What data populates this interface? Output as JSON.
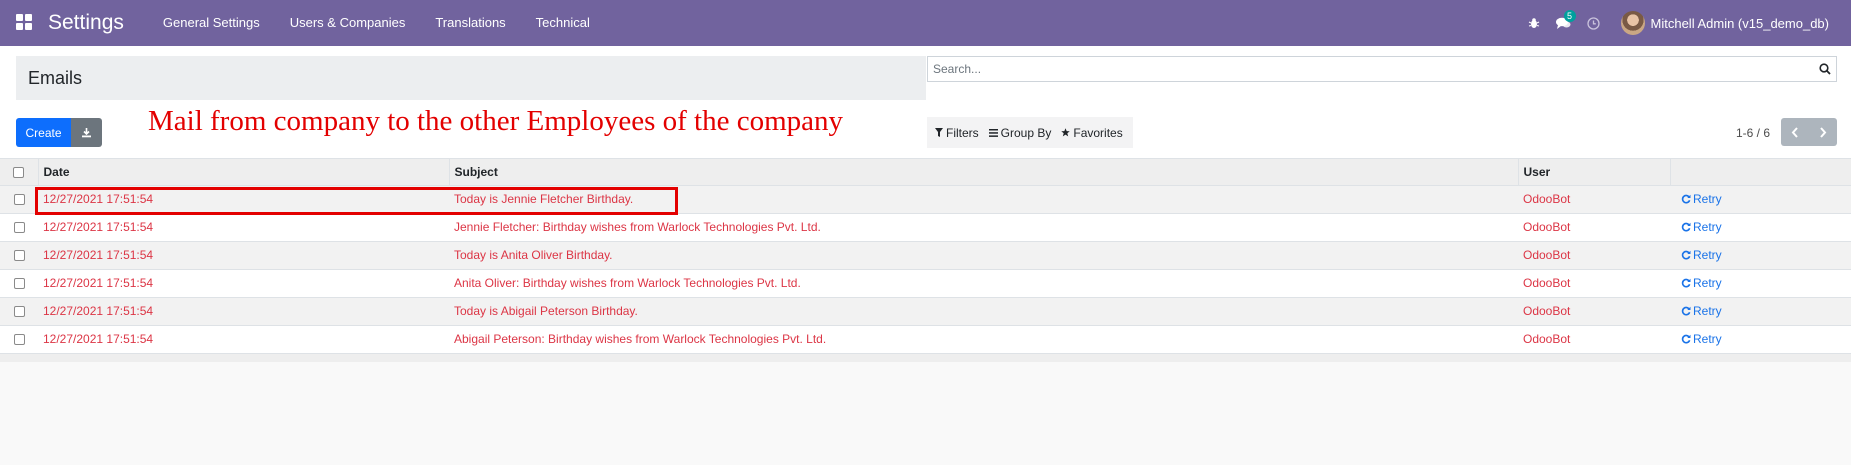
{
  "navbar": {
    "app_title": "Settings",
    "menu": [
      "General Settings",
      "Users & Companies",
      "Translations",
      "Technical"
    ],
    "messages_count": "5",
    "user_name": "Mitchell Admin (v15_demo_db)",
    "icons": [
      "apps-icon",
      "bug-icon",
      "chat-icon",
      "clock-icon"
    ]
  },
  "control": {
    "title": "Emails",
    "search_placeholder": "Search...",
    "create_label": "Create",
    "filters_label": "Filters",
    "groupby_label": "Group By",
    "favorites_label": "Favorites",
    "pager": "1-6 / 6"
  },
  "annotation": "Mail from company to the other Employees of the company",
  "table": {
    "columns": [
      "Date",
      "Subject",
      "User"
    ],
    "retry_label": "Retry",
    "rows": [
      {
        "date": "12/27/2021 17:51:54",
        "subject": "Today is Jennie Fletcher Birthday.",
        "user": "OdooBot"
      },
      {
        "date": "12/27/2021 17:51:54",
        "subject": "Jennie Fletcher: Birthday wishes from Warlock Technologies Pvt. Ltd.",
        "user": "OdooBot"
      },
      {
        "date": "12/27/2021 17:51:54",
        "subject": "Today is Anita Oliver Birthday.",
        "user": "OdooBot"
      },
      {
        "date": "12/27/2021 17:51:54",
        "subject": "Anita Oliver: Birthday wishes from Warlock Technologies Pvt. Ltd.",
        "user": "OdooBot"
      },
      {
        "date": "12/27/2021 17:51:54",
        "subject": "Today is Abigail Peterson Birthday.",
        "user": "OdooBot"
      },
      {
        "date": "12/27/2021 17:51:54",
        "subject": "Abigail Peterson: Birthday wishes from Warlock Technologies Pvt. Ltd.",
        "user": "OdooBot"
      }
    ]
  },
  "colors": {
    "navbar": "#71639e",
    "failed_text": "#dc3545",
    "retry_link": "#1a73e8",
    "primary_button": "#0d6efd",
    "annotation": "#e30000"
  }
}
